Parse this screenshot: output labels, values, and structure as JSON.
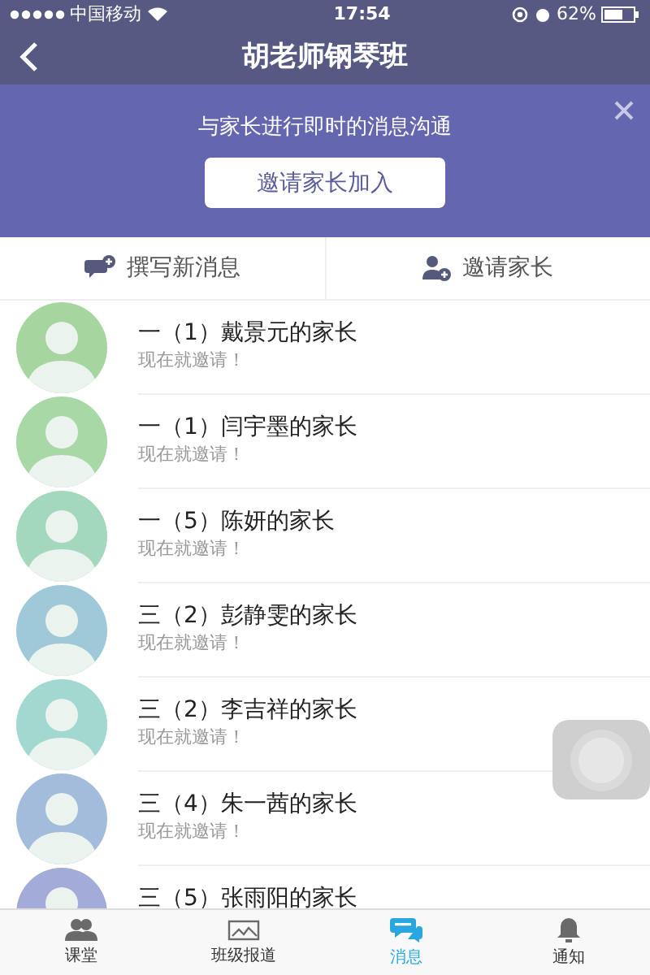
{
  "status_bar": {
    "carrier": "中国移动",
    "time": "17:54",
    "battery": "62%"
  },
  "nav": {
    "title": "胡老师钢琴班"
  },
  "banner": {
    "text": "与家长进行即时的消息沟通",
    "button": "邀请家长加入"
  },
  "actions": [
    {
      "kind": "compose",
      "label": "撰写新消息"
    },
    {
      "kind": "invite",
      "label": "邀请家长"
    }
  ],
  "contacts": [
    {
      "name": "一（1）戴景元的家长",
      "subtitle": "现在就邀请！",
      "color": "#a6d5a0"
    },
    {
      "name": "一（1）闫宇墨的家长",
      "subtitle": "现在就邀请！",
      "color": "#a8d8a6"
    },
    {
      "name": "一（5）陈妍的家长",
      "subtitle": "现在就邀请！",
      "color": "#a4d8bc"
    },
    {
      "name": "三（2）彭静雯的家长",
      "subtitle": "现在就邀请！",
      "color": "#9fc9d8"
    },
    {
      "name": "三（2）李吉祥的家长",
      "subtitle": "现在就邀请！",
      "color": "#a2d8d0"
    },
    {
      "name": "三（4）朱一茜的家长",
      "subtitle": "现在就邀请！",
      "color": "#a3bcdc"
    },
    {
      "name": "三（5）张雨阳的家长",
      "color": "#a3abd8"
    }
  ],
  "tabs": [
    {
      "kind": "people",
      "label": "课堂",
      "selected": false
    },
    {
      "kind": "picture",
      "label": "班级报道",
      "selected": false
    },
    {
      "kind": "chat",
      "label": "消息",
      "selected": true
    },
    {
      "kind": "bell",
      "label": "通知",
      "selected": false
    }
  ]
}
